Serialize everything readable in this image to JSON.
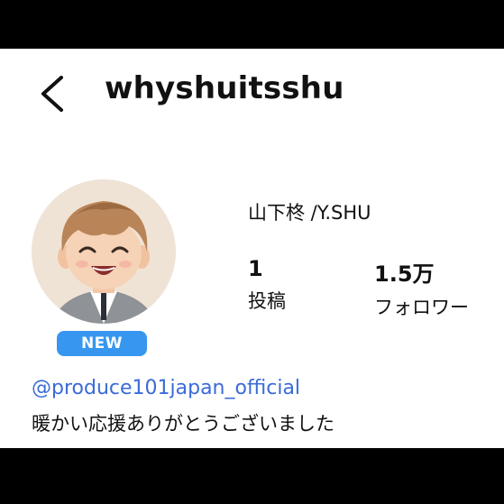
{
  "header": {
    "username": "whyshuitsshu",
    "back_icon": "chevron-left-icon"
  },
  "profile": {
    "display_name": "山下柊 /Y.SHU",
    "new_badge": "NEW",
    "stats": [
      {
        "value": "1",
        "label": "投稿"
      },
      {
        "value": "1.5万",
        "label": "フォロワー"
      }
    ],
    "mention": "@produce101japan_official",
    "bio": "暖かい応援ありがとうございました"
  },
  "colors": {
    "accent": "#3797f0",
    "link": "#3a6bd9"
  }
}
